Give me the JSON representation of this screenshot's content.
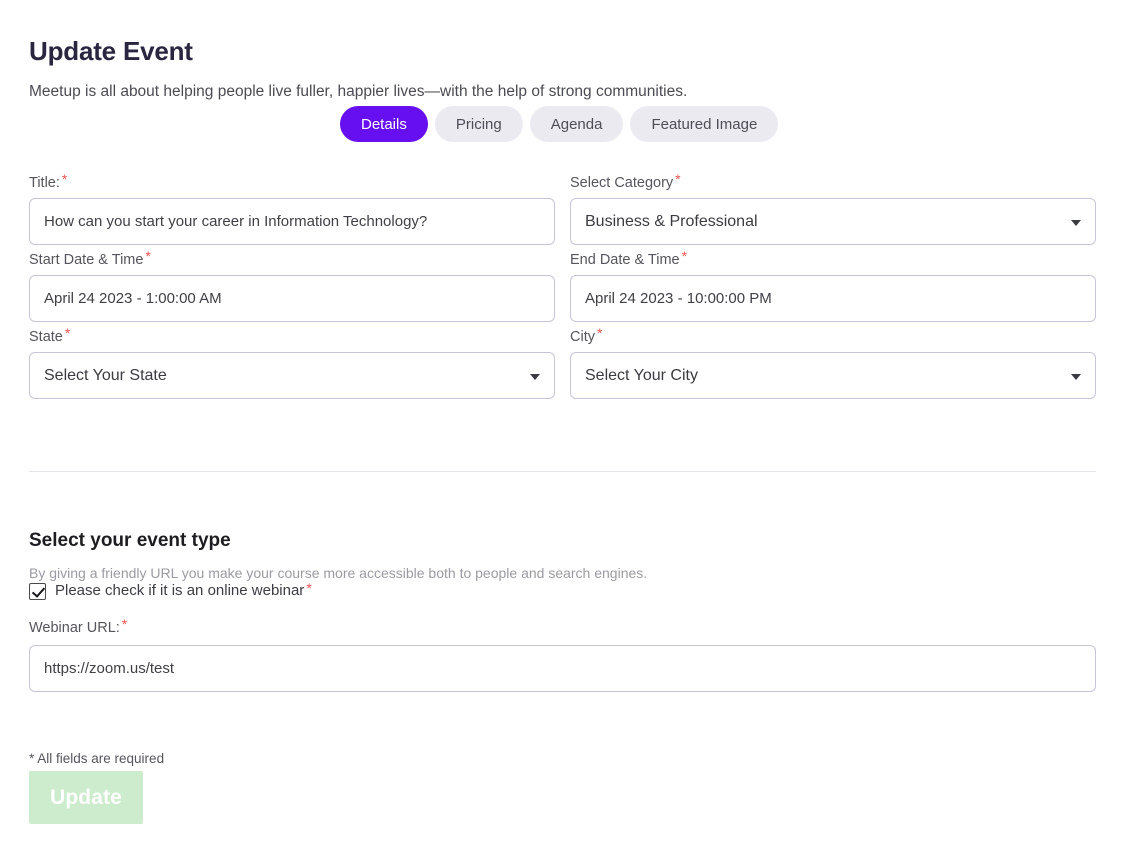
{
  "header": {
    "title": "Update Event",
    "subtitle": "Meetup is all about helping people live fuller, happier lives—with the help of strong communities."
  },
  "tabs": [
    {
      "label": "Details",
      "active": true
    },
    {
      "label": "Pricing",
      "active": false
    },
    {
      "label": "Agenda",
      "active": false
    },
    {
      "label": "Featured Image",
      "active": false
    }
  ],
  "required_marker": "*",
  "form": {
    "title": {
      "label": "Title:",
      "value": "How can you start your career in Information Technology?",
      "required": true
    },
    "category": {
      "label": "Select Category",
      "value": "Business & Professional",
      "required": true,
      "icon": "chevron-down-icon"
    },
    "start_datetime": {
      "label": "Start Date & Time",
      "value": "April 24 2023 - 1:00:00 AM",
      "required": true
    },
    "end_datetime": {
      "label": "End Date & Time",
      "value": "April 24 2023 - 10:00:00 PM",
      "required": true
    },
    "state": {
      "label": "State",
      "value": "Select Your State",
      "required": true,
      "icon": "chevron-down-icon"
    },
    "city": {
      "label": "City",
      "value": "Select Your City",
      "required": true,
      "icon": "chevron-down-icon"
    }
  },
  "event_type": {
    "title": "Select your event type",
    "description": "By giving a friendly URL you make your course more accessible both to people and search engines.",
    "checkbox_label": "Please check if it is an online webinar",
    "checkbox_checked": true,
    "webinar_url": {
      "label": "Webinar URL:",
      "value": "https://zoom.us/test",
      "required": true
    }
  },
  "footer": {
    "required_note": "* All fields are required",
    "update_label": "Update"
  },
  "colors": {
    "accent_purple": "#6610f2",
    "tab_inactive_bg": "#eceaf1",
    "required_red": "#e8564f",
    "button_green": "#cdecce",
    "border": "#c8c5d8",
    "heading": "#2b2640"
  }
}
